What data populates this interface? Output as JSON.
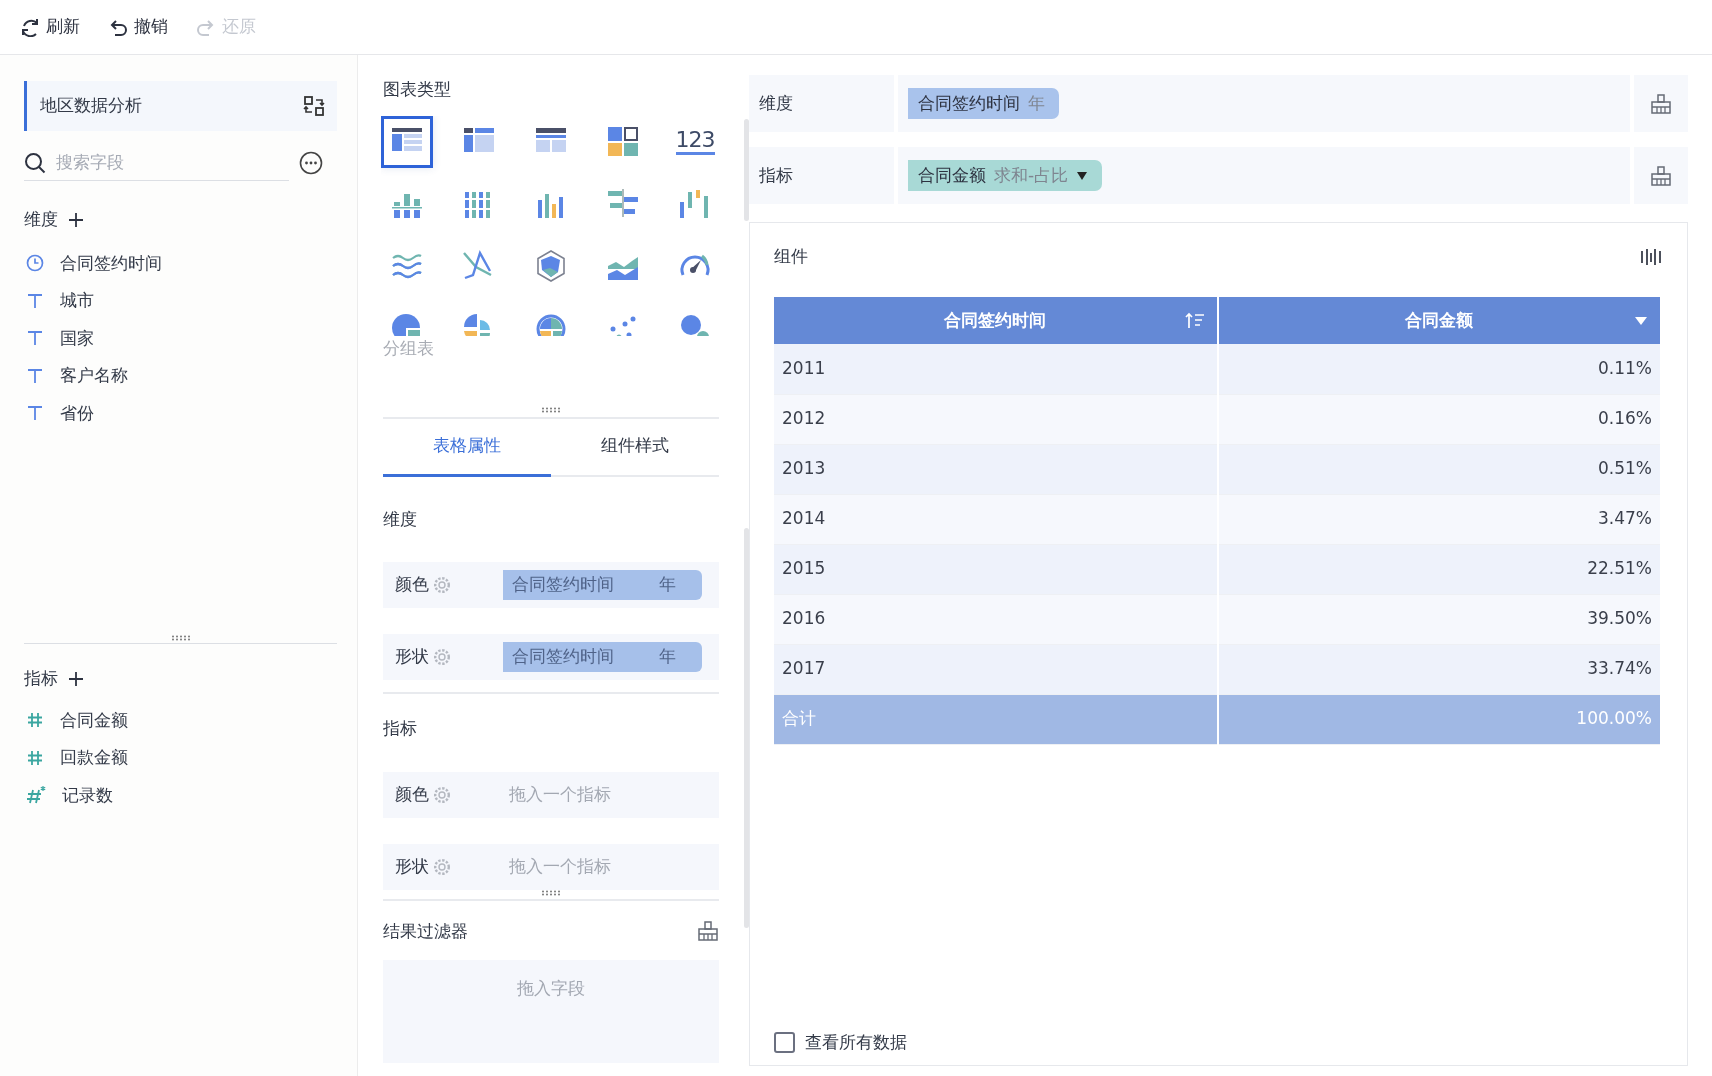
{
  "toolbar": [
    {
      "kind": "refresh",
      "label": "刷新",
      "disabled": false
    },
    {
      "kind": "undo",
      "label": "撤销",
      "disabled": false
    },
    {
      "kind": "redo",
      "label": "还原",
      "disabled": true
    }
  ],
  "fields_panel": {
    "dataset": "地区数据分析",
    "search": {
      "placeholder": "搜索字段"
    },
    "dimensions": {
      "title": "维度",
      "items": [
        {
          "name": "合同签约时间",
          "kind": "time"
        },
        {
          "name": "城市",
          "kind": "text"
        },
        {
          "name": "国家",
          "kind": "text"
        },
        {
          "name": "客户名称",
          "kind": "text"
        },
        {
          "name": "省份",
          "kind": "text"
        }
      ]
    },
    "measures": {
      "title": "指标",
      "items": [
        {
          "name": "合同金额",
          "kind": "number"
        },
        {
          "name": "回款金额",
          "kind": "number"
        },
        {
          "name": "记录数",
          "kind": "count"
        }
      ]
    }
  },
  "chart_types": {
    "title": "图表类型",
    "items": [
      {
        "kind": "group-table",
        "selected": true
      },
      {
        "kind": "cross-table",
        "selected": false
      },
      {
        "kind": "detail-table",
        "selected": false
      },
      {
        "kind": "blocks",
        "selected": false
      },
      {
        "kind": "number",
        "text": "123",
        "selected": false
      },
      {
        "kind": "bar-stack",
        "selected": false
      },
      {
        "kind": "bar-multi",
        "selected": false
      },
      {
        "kind": "bar",
        "selected": false
      },
      {
        "kind": "bar-h",
        "selected": false
      },
      {
        "kind": "waterfall",
        "selected": false
      },
      {
        "kind": "line-wave",
        "selected": false
      },
      {
        "kind": "line-cross",
        "selected": false
      },
      {
        "kind": "radar",
        "selected": false
      },
      {
        "kind": "area",
        "selected": false
      },
      {
        "kind": "gauge",
        "selected": false
      },
      {
        "kind": "pie",
        "selected": false
      },
      {
        "kind": "pie-multi",
        "selected": false
      },
      {
        "kind": "donut",
        "selected": false
      },
      {
        "kind": "scatter",
        "selected": false
      },
      {
        "kind": "bubble",
        "selected": false
      }
    ],
    "caption": "分组表"
  },
  "tabs": [
    {
      "label": "表格属性",
      "selected": true
    },
    {
      "label": "组件样式",
      "selected": false
    }
  ],
  "properties": {
    "sections": [
      {
        "title": "维度",
        "slots": [
          {
            "label": "颜色",
            "pill": {
              "name": "合同签约时间",
              "unit": "年"
            }
          },
          {
            "label": "形状",
            "pill": {
              "name": "合同签约时间",
              "unit": "年"
            }
          }
        ]
      },
      {
        "title": "指标",
        "slots": [
          {
            "label": "颜色",
            "hint": "拖入一个指标"
          },
          {
            "label": "形状",
            "hint": "拖入一个指标"
          }
        ]
      }
    ],
    "result_filter": {
      "title": "结果过滤器",
      "hint": "拖入字段"
    }
  },
  "shelves": [
    {
      "label": "维度",
      "pills": [
        {
          "kind": "dimension",
          "name": "合同签约时间",
          "detail": "年",
          "dropdown": false
        }
      ]
    },
    {
      "label": "指标",
      "pills": [
        {
          "kind": "measure",
          "name": "合同金额",
          "detail": "求和-占比",
          "dropdown": true
        }
      ]
    }
  ],
  "component": {
    "title": "组件",
    "table": {
      "columns": [
        {
          "label": "合同签约时间"
        },
        {
          "label": "合同金额"
        }
      ],
      "rows": [
        [
          "2011",
          "0.11%"
        ],
        [
          "2012",
          "0.16%"
        ],
        [
          "2013",
          "0.51%"
        ],
        [
          "2014",
          "3.47%"
        ],
        [
          "2015",
          "22.51%"
        ],
        [
          "2016",
          "39.50%"
        ],
        [
          "2017",
          "33.74%"
        ]
      ],
      "total": [
        "合计",
        "100.00%"
      ]
    },
    "view_all": {
      "label": "查看所有数据",
      "checked": false
    }
  }
}
